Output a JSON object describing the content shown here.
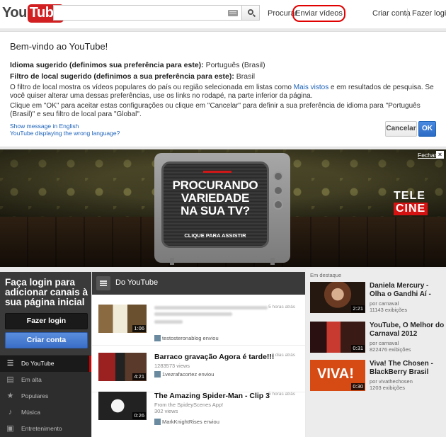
{
  "header": {
    "logo_you": "You",
    "logo_tube": "Tube",
    "search_placeholder": "",
    "search_link": "Procurar",
    "upload_label": "Enviar vídeos",
    "create_account": "Criar conta",
    "login": "Fazer login"
  },
  "welcome": {
    "title": "Bem-vindo ao YouTube!",
    "language_label": "Idioma sugerido (definimos sua preferência para este):",
    "language_value": "Português (Brasil)",
    "location_label": "Filtro de local sugerido (definimos a sua preferência para este):",
    "location_value": "Brasil",
    "para1_a": "O filtro de local mostra os vídeos populares do país ou região selecionada em listas como ",
    "para1_link": "Mais vistos",
    "para1_b": " e em resultados de pesquisa. Se você quiser alterar uma dessas preferências, use os links no rodapé, na parte inferior da página.",
    "para2": "Clique em \"OK\" para aceitar estas configurações ou clique em \"Cancelar\" para definir a sua preferência de idioma para \"Português (Brasil)\" e seu filtro de local para \"Global\".",
    "link_english": "Show message in English",
    "link_wrong_language": "YouTube displaying the wrong language?",
    "cancel_label": "Cancelar",
    "ok_label": "OK"
  },
  "banner": {
    "headline_1": "PROCURANDO",
    "headline_2": "VARIEDADE",
    "headline_3": "NA SUA TV?",
    "cta": "CLIQUE PARA ASSISTIR",
    "brand_top": "TELE",
    "brand_bottom": "CINE",
    "close_label": "Fechar",
    "close_x": "×"
  },
  "left_panel": {
    "title": "Faça login para adicionar canais à sua página inicial",
    "login_button": "Fazer login",
    "create_button": "Criar conta",
    "nav": [
      {
        "label": "Do YouTube",
        "icon": "list-icon"
      },
      {
        "label": "Em alta",
        "icon": "trending-icon"
      },
      {
        "label": "Populares",
        "icon": "star-icon"
      },
      {
        "label": "Música",
        "icon": "music-icon"
      },
      {
        "label": "Entretenimento",
        "icon": "entertainment-icon"
      }
    ]
  },
  "feed": {
    "title": "Do YouTube",
    "items": [
      {
        "title": "",
        "time": "5 horas atrás",
        "duration": "1:06",
        "meta": "",
        "user": "testosteronablog enviou"
      },
      {
        "title": "Barraco gravação Agora é tarde!!!",
        "time": "3 dias atrás",
        "duration": "4:21",
        "meta": "1283573 views",
        "user": "1vezrafacortez enviou"
      },
      {
        "title": "The Amazing Spider-Man - Clip 3",
        "time": "5 horas atrás",
        "duration": "0:26",
        "meta": "From the SpideyScenes App!",
        "meta2": "302 views",
        "user": "MarkKnightRises enviou"
      }
    ]
  },
  "featured": {
    "label": "Em destaque",
    "items": [
      {
        "title": "Daniela Mercury - Olha o Gandhi Aí -",
        "channel": "por carnaval",
        "views": "11143 exibições",
        "duration": "2:21"
      },
      {
        "title": "YouTube, O Melhor do Carnaval 2012",
        "channel": "por carnaval",
        "views": "822476 exibições",
        "duration": "0:31"
      },
      {
        "title": "Viva! The Chosen - BlackBerry Brasil",
        "channel": "por vivathechosen",
        "views": "1203 exibições",
        "duration": "0:30",
        "thumb_text": "VIVA!"
      }
    ]
  }
}
